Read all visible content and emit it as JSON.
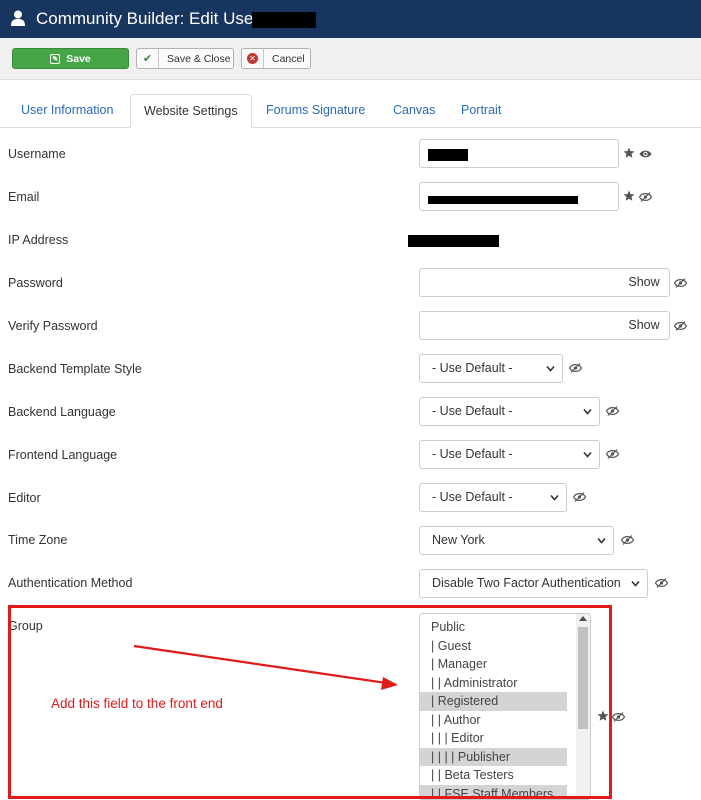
{
  "header": {
    "title": "Community Builder: Edit User [",
    "icon": "user-icon"
  },
  "toolbar": {
    "save_label": "Save",
    "save_close_label": "Save & Close",
    "cancel_label": "Cancel"
  },
  "tabs": [
    {
      "label": "User Information",
      "active": false
    },
    {
      "label": "Website Settings",
      "active": true
    },
    {
      "label": "Forums Signature",
      "active": false
    },
    {
      "label": "Canvas",
      "active": false
    },
    {
      "label": "Portrait",
      "active": false
    }
  ],
  "form": {
    "username_label": "Username",
    "email_label": "Email",
    "ip_label": "IP Address",
    "password_label": "Password",
    "password_show": "Show",
    "verify_password_label": "Verify Password",
    "verify_password_show": "Show",
    "backend_template_label": "Backend Template Style",
    "backend_template_value": "- Use Default -",
    "backend_language_label": "Backend Language",
    "backend_language_value": "- Use Default -",
    "frontend_language_label": "Frontend Language",
    "frontend_language_value": "- Use Default -",
    "editor_label": "Editor",
    "editor_value": "- Use Default -",
    "timezone_label": "Time Zone",
    "timezone_value": "New York",
    "auth_method_label": "Authentication Method",
    "auth_method_value": "Disable Two Factor Authentication",
    "group_label": "Group",
    "group_options": [
      {
        "label": "Public",
        "selected": false
      },
      {
        "label": "| Guest",
        "selected": false
      },
      {
        "label": "| Manager",
        "selected": false
      },
      {
        "label": "| | Administrator",
        "selected": false
      },
      {
        "label": "| Registered",
        "selected": true
      },
      {
        "label": "| | Author",
        "selected": false
      },
      {
        "label": "| | | Editor",
        "selected": false
      },
      {
        "label": "| | | | Publisher",
        "selected": true
      },
      {
        "label": "| | Beta Testers",
        "selected": false
      },
      {
        "label": "| | FSE Staff Members",
        "selected": true
      }
    ]
  },
  "annotation": {
    "text": "Add this field to the front end",
    "color": "#e11a1a"
  },
  "colors": {
    "header_bg": "#17355e",
    "save_green": "#46a546",
    "link_blue": "#2a69b8"
  }
}
